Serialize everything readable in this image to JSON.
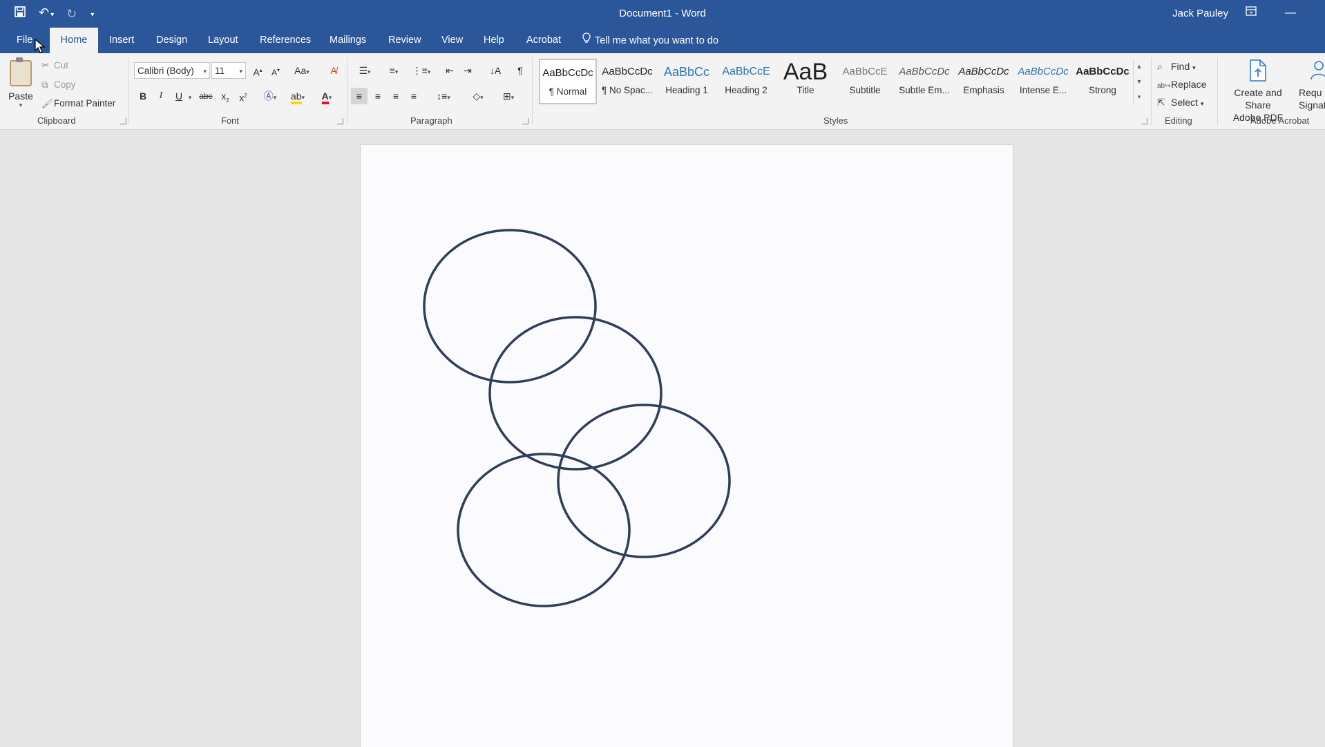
{
  "title_bar": {
    "doc_name": "Document1",
    "separator": "-",
    "app_name": "Word",
    "user": "Jack Pauley"
  },
  "tabs": [
    {
      "label": "File"
    },
    {
      "label": "Home",
      "active": true
    },
    {
      "label": "Insert"
    },
    {
      "label": "Design"
    },
    {
      "label": "Layout"
    },
    {
      "label": "References"
    },
    {
      "label": "Mailings"
    },
    {
      "label": "Review"
    },
    {
      "label": "View"
    },
    {
      "label": "Help"
    },
    {
      "label": "Acrobat"
    }
  ],
  "tell_me": "Tell me what you want to do",
  "clipboard": {
    "paste": "Paste",
    "cut": "Cut",
    "copy": "Copy",
    "format_painter": "Format Painter",
    "label": "Clipboard"
  },
  "font": {
    "face": "Calibri (Body)",
    "size": "11",
    "grow": "A",
    "shrink": "A",
    "case": "Aa",
    "bold": "B",
    "italic": "I",
    "underline": "U",
    "strike": "abc",
    "subscript": "x",
    "superscript": "x",
    "label": "Font"
  },
  "paragraph": {
    "label": "Paragraph"
  },
  "styles": {
    "items": [
      {
        "sample": "AaBbCcDc",
        "name": "¶ Normal",
        "active": true
      },
      {
        "sample": "AaBbCcDc",
        "name": "¶ No Spac..."
      },
      {
        "sample": "AaBbCc",
        "name": "Heading 1"
      },
      {
        "sample": "AaBbCcE",
        "name": "Heading 2"
      },
      {
        "sample": "AaB",
        "name": "Title"
      },
      {
        "sample": "AaBbCcE",
        "name": "Subtitle"
      },
      {
        "sample": "AaBbCcDc",
        "name": "Subtle Em..."
      },
      {
        "sample": "AaBbCcDc",
        "name": "Emphasis"
      },
      {
        "sample": "AaBbCcDc",
        "name": "Intense E..."
      },
      {
        "sample": "AaBbCcDc",
        "name": "Strong"
      }
    ],
    "label": "Styles"
  },
  "editing": {
    "find": "Find",
    "replace": "Replace",
    "select": "Select",
    "label": "Editing"
  },
  "acrobat": {
    "create_line1": "Create and Share",
    "create_line2": "Adobe PDF",
    "request_line1": "Requ",
    "request_line2": "Signat",
    "label": "Adobe Acrobat"
  },
  "colors": {
    "brand": "#2b579a",
    "circle_stroke": "#2f3e5a",
    "font_color": "#e81123",
    "highlight": "#ffd800"
  },
  "document": {
    "shapes": [
      {
        "type": "ellipse",
        "name": "circle-top-left"
      },
      {
        "type": "ellipse",
        "name": "circle-middle"
      },
      {
        "type": "ellipse",
        "name": "circle-right"
      },
      {
        "type": "ellipse",
        "name": "circle-bottom-left"
      }
    ]
  }
}
